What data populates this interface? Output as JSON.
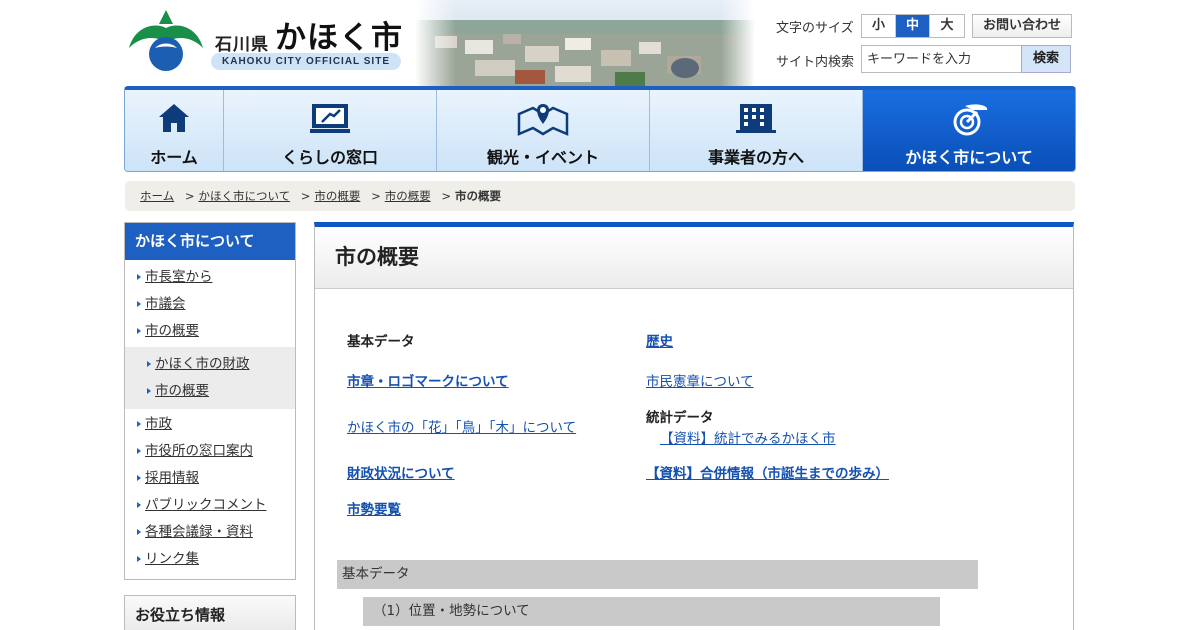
{
  "header": {
    "pref": "石川県",
    "city": "かほく市",
    "subtitle": "KAHOKU CITY OFFICIAL SITE",
    "font_size_label": "文字のサイズ",
    "font_sizes": [
      "小",
      "中",
      "大"
    ],
    "font_size_selected": "中",
    "contact": "お問い合わせ",
    "search_label": "サイト内検索",
    "search_placeholder": "キーワードを入力",
    "search_button": "検索"
  },
  "nav": [
    {
      "label": "ホーム",
      "icon": "home-icon"
    },
    {
      "label": "くらしの窓口",
      "icon": "computer-icon"
    },
    {
      "label": "観光・イベント",
      "icon": "map-pin-icon"
    },
    {
      "label": "事業者の方へ",
      "icon": "building-icon"
    },
    {
      "label": "かほく市について",
      "icon": "city-emblem-icon",
      "active": true
    }
  ],
  "breadcrumb": [
    "ホーム",
    "かほく市について",
    "市の概要",
    "市の概要",
    "市の概要"
  ],
  "sidebar": {
    "title": "かほく市について",
    "items": [
      "市長室から",
      "市議会",
      "市の概要"
    ],
    "sub_items": [
      "かほく市の財政",
      "市の概要"
    ],
    "items_after": [
      "市政",
      "市役所の窓口案内",
      "採用情報",
      "パブリックコメント",
      "各種会議録・資料",
      "リンク集"
    ],
    "secondary_title": "お役立ち情報"
  },
  "main": {
    "title": "市の概要",
    "links": {
      "basic_data": "基本データ",
      "history": "歴史",
      "emblem": "市章・ロゴマークについて",
      "charter": "市民憲章について",
      "symbols": "かほく市の「花」「鳥」「木」について",
      "stats_heading": "統計データ",
      "stats_link": "【資料】統計でみるかほく市",
      "finance": "財政状況について",
      "merger": "【資料】合併情報（市誕生までの歩み）",
      "overview_book": "市勢要覧"
    },
    "section_band": "基本データ",
    "subsection_band": "（1）位置・地勢について"
  },
  "colors": {
    "accent": "#1e5fc2",
    "link": "#1551b0"
  }
}
